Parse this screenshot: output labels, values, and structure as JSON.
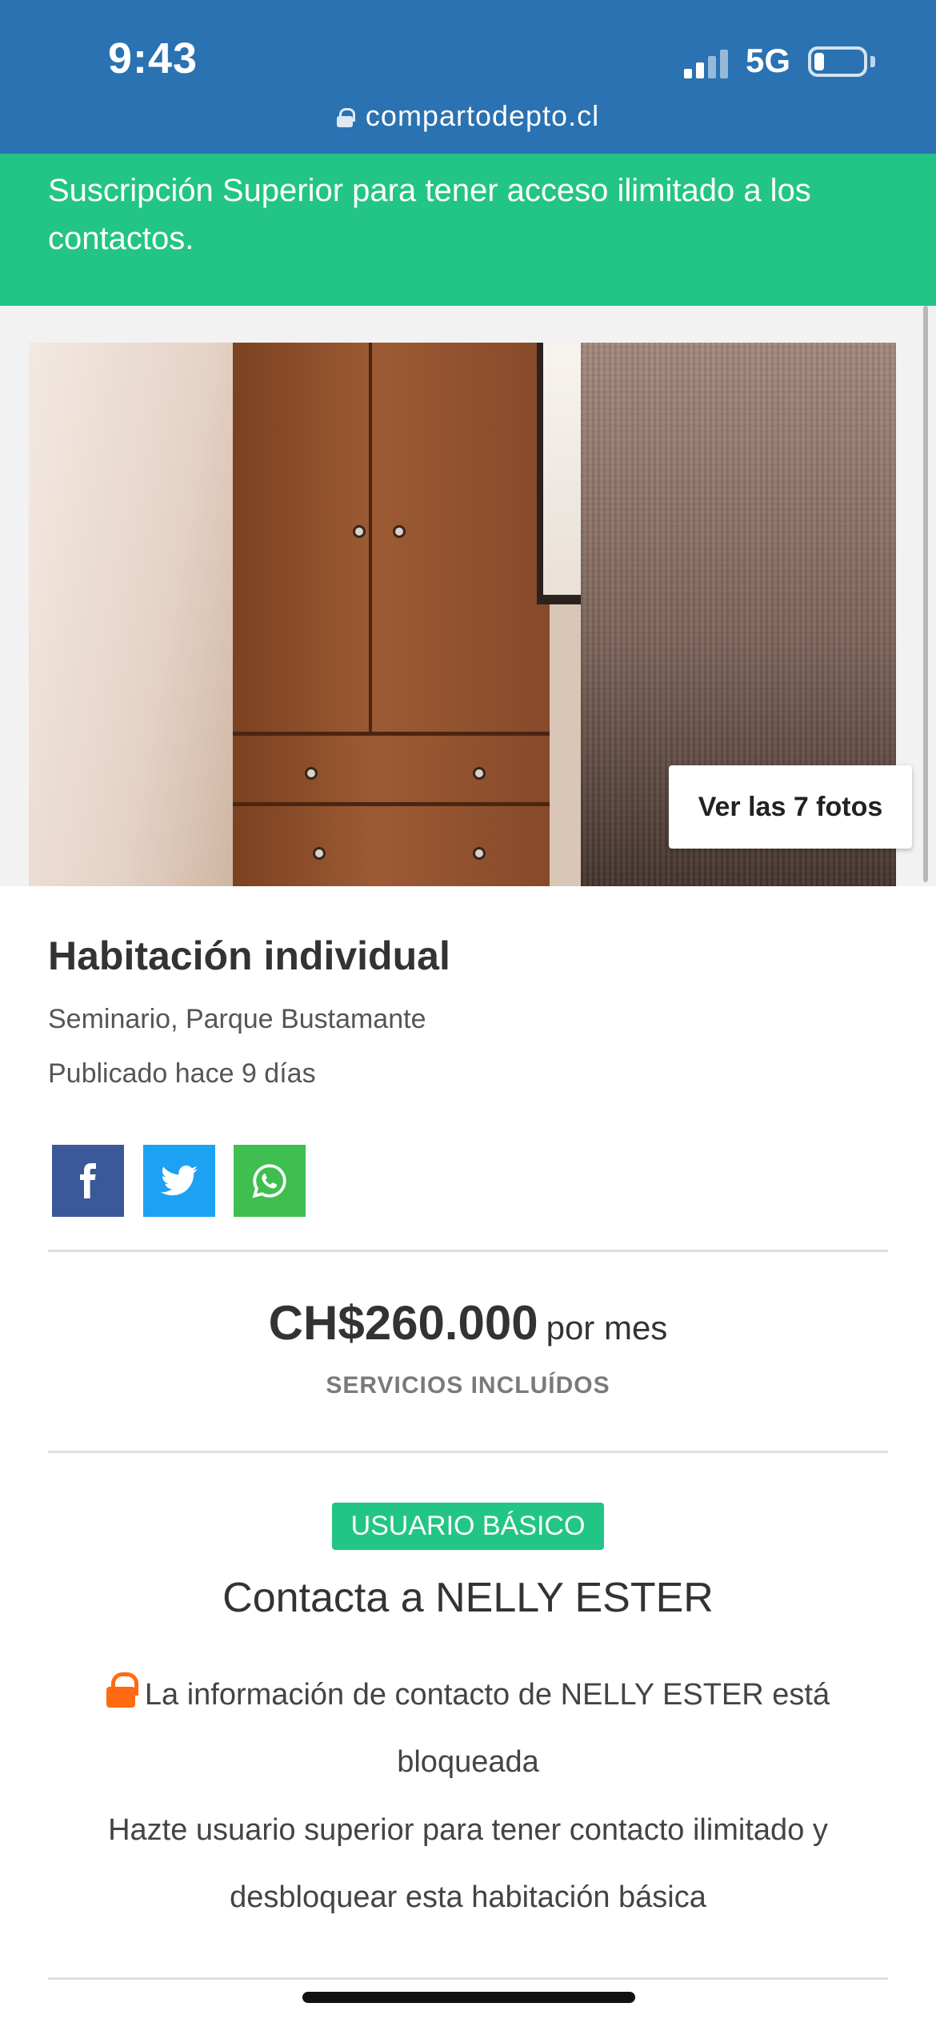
{
  "status_bar": {
    "time": "9:43",
    "network": "5G",
    "url": "compartodepto.cl"
  },
  "banner": {
    "text": "Suscripción Superior para tener acceso ilimitado a los contactos.",
    "color": "#22c585"
  },
  "gallery": {
    "photos_button_label": "Ver las 7 fotos"
  },
  "listing": {
    "title": "Habitación individual",
    "location": "Seminario, Parque Bustamante",
    "published": "Publicado hace 9 días"
  },
  "share": {
    "icons": [
      "facebook-icon",
      "twitter-icon",
      "whatsapp-icon"
    ],
    "colors": {
      "facebook": "#3b5998",
      "twitter": "#1da1f2",
      "whatsapp": "#3ebf4f"
    }
  },
  "price": {
    "amount": "CH$260.000",
    "period": "por mes",
    "services": "SERVICIOS INCLUÍDOS"
  },
  "contact": {
    "badge": "USUARIO BÁSICO",
    "title": "Contacta a NELLY ESTER",
    "locked_text": "La información de contacto de NELLY ESTER está bloqueada",
    "upgrade_text": "Hazte usuario superior para tener contacto ilimitado y desbloquear esta habitación básica",
    "lock_color": "#ff6a13"
  },
  "theme": {
    "header_blue": "#2a72b1",
    "accent_green": "#22c585"
  }
}
